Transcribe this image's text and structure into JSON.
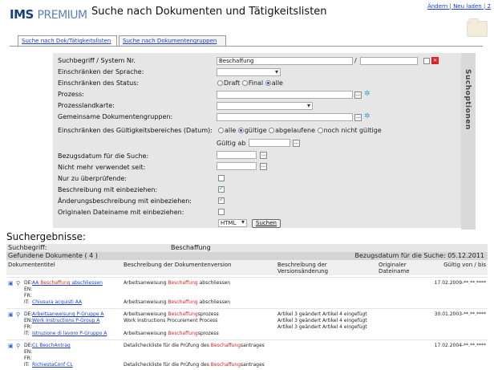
{
  "app": {
    "logo_brand": "IMS",
    "logo_premium": "PREMIUM",
    "title": "Suche nach Dokumenten und Tätigkeitslisten"
  },
  "toplinks": {
    "change": "Ändern",
    "reload": "Neu laden",
    "sep": "|",
    "more": "2"
  },
  "tabs": [
    {
      "label": "Suche nach Dok/Tätigkeitslisten"
    },
    {
      "label": "Suche nach Dokumentengruppen"
    }
  ],
  "form": {
    "side_label": "Suchoptionen",
    "labels": {
      "search": "Suchbegriff / System Nr.",
      "language": "Einschränken der Sprache:",
      "status": "Einschränken des Status:",
      "process": "Prozess:",
      "processmap": "Prozesslandkarte:",
      "groups": "Gemeinsame Dokumentengruppen:",
      "validity": "Einschränken des Gültigkeitsbereiches (Datum):",
      "refdate": "Bezugsdatum für die Suche:",
      "notused": "Nicht mehr verwendet seit:",
      "onlycheck": "Nur zu überprüfende:",
      "desc": "Beschreibung mit einbeziehen:",
      "changedesc": "Änderungsbeschreibung mit einbeziehen:",
      "origname": "Originalen Dateiname mit einbeziehen:"
    },
    "search_value": "Beschaffung",
    "search_sep": "/",
    "status_options": [
      "Draft",
      "Final",
      "alle"
    ],
    "status_selected": "alle",
    "validity_options": [
      "alle",
      "gültige",
      "abgelaufene",
      "noch nicht gültige"
    ],
    "validity_selected": "gültige",
    "valid_from_label": "Gültig ab",
    "checks": {
      "onlycheck": false,
      "desc": true,
      "changedesc": true,
      "origname": false
    },
    "format_value": "HTML",
    "search_button": "Suchen"
  },
  "results": {
    "heading": "Suchergebnisse:",
    "term_label": "Suchbegriff:",
    "term_value": "Beschaffung",
    "found_label": "Gefundene Dokumente ( 4 )",
    "refdate_label": "Bezugsdatum für die Suche:",
    "refdate_value": "05.12.2011",
    "columns": {
      "title": "Dokumententitel",
      "version_desc": "Beschreibung der Dokumentenversion",
      "change_desc": "Beschreibung der Versionsänderung",
      "orig_file": "Originaler Dateiname",
      "valid": "Gültig von / bis"
    },
    "rows": [
      {
        "lines": [
          {
            "lang": "DE:",
            "title": "AA Beschaffung abschliessen",
            "desc": "Arbeitsanweisung Beschaffung abschliessen"
          },
          {
            "lang": "EN:",
            "title": "",
            "desc": ""
          },
          {
            "lang": "FR:",
            "title": "",
            "desc": ""
          },
          {
            "lang": "IT:",
            "title": "Chiusura acquisti AA",
            "desc": "Arbeitsanweisung Beschaffung abschliessen"
          }
        ],
        "change": [
          "",
          ""
        ],
        "valid": "17.02.2009-**.**.****"
      },
      {
        "lines": [
          {
            "lang": "DE:",
            "title": "Arbeitsanweisung P-Gruppe A",
            "desc": "Arbeitsanweisung Beschaffungsprozess"
          },
          {
            "lang": "EN:",
            "title": "Work Instructions P-Group A",
            "desc": "Work Instructions Procurement Process"
          },
          {
            "lang": "FR:",
            "title": "",
            "desc": ""
          },
          {
            "lang": "IT:",
            "title": "Istruzione di lavoro P-Gruppo A",
            "desc": "Arbeitsanweisung Beschaffungsprozess"
          }
        ],
        "change": [
          "Artikel 3 geändert Artikel 4 eingefügt",
          "Artikel 3 geändert Artikel 4 eingefügt",
          "Artikel 3 geändert Artikel 4 eingefügt"
        ],
        "valid": "30.01.2003-**.**.****"
      },
      {
        "lines": [
          {
            "lang": "DE:",
            "title": "CL BeschAntrag",
            "desc": "Detailcheckliste für die Prüfung des Beschaffungsantrages"
          },
          {
            "lang": "EN:",
            "title": "",
            "desc": ""
          },
          {
            "lang": "FR:",
            "title": "",
            "desc": ""
          },
          {
            "lang": "IT:",
            "title": "RichiestaConf CL",
            "desc": "Detailcheckliste für die Prüfung des Beschaffungsantrages"
          }
        ],
        "change": [
          "",
          ""
        ],
        "valid": "17.02.2004-**.**.****"
      }
    ]
  }
}
